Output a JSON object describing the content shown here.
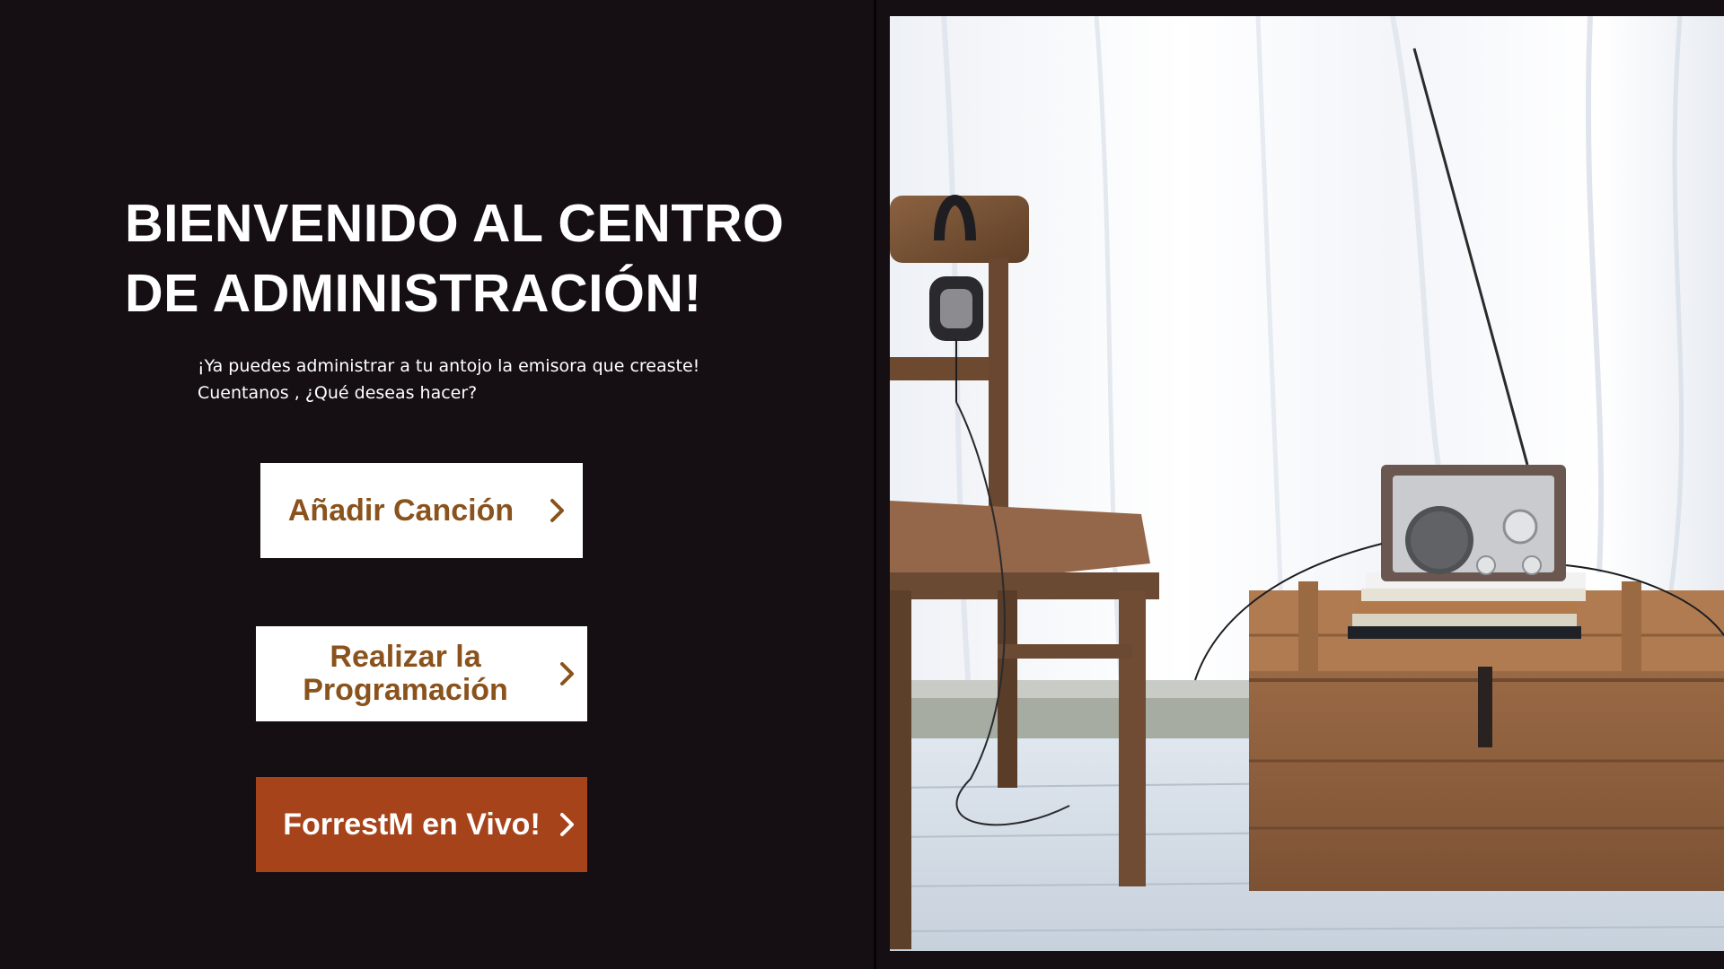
{
  "welcome": {
    "title": "BIENVENIDO AL CENTRO DE ADMINISTRACIÓN!",
    "subtitle_line1": "¡Ya puedes administrar a tu antojo la emisora que creaste!",
    "subtitle_line2": "Cuentanos , ¿Qué deseas hacer?"
  },
  "actions": {
    "add_song": "Añadir Canción",
    "schedule": "Realizar la Programación",
    "live": "ForrestM en Vivo!"
  },
  "colors": {
    "background": "#150e12",
    "button_text": "#8a521c",
    "button_bg": "#ffffff",
    "live_bg": "#a6431a"
  },
  "icons": {
    "chevron": "chevron-right-icon"
  }
}
